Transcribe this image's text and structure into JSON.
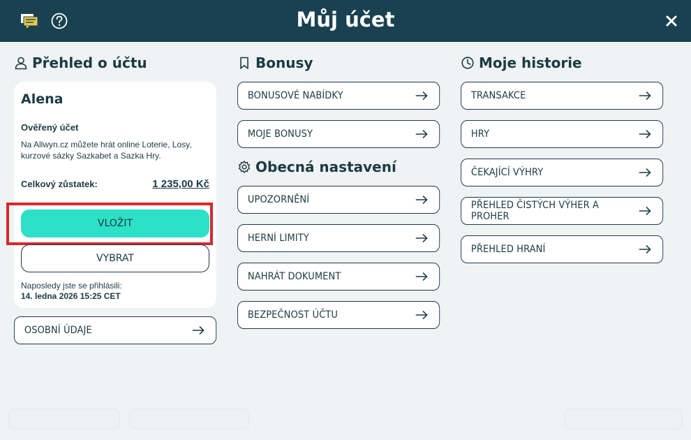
{
  "header": {
    "title": "Můj účet",
    "colors": {
      "header_bg": "#1a4150",
      "accent": "#2de0c8",
      "highlight": "#d62830"
    }
  },
  "overview": {
    "title": "Přehled o účtu",
    "name": "Alena",
    "verified": "Ověřený účet",
    "description": "Na Allwyn.cz můžete hrát online Loterie, Losy, kurzové sázky Sazkabet a Sazka Hry.",
    "balance_label": "Celkový zůstatek:",
    "balance_value": "1 235,00 Kč",
    "deposit_label": "VLOŽIT",
    "withdraw_label": "VYBRAT",
    "last_login_label": "Naposledy jste se přihlásili:",
    "last_login_value": "14. ledna 2026 15:25 CET",
    "personal_data": "OSOBNÍ ÚDAJE"
  },
  "bonuses": {
    "title": "Bonusy",
    "items": [
      "BONUSOVÉ NABÍDKY",
      "MOJE BONUSY"
    ]
  },
  "settings": {
    "title": "Obecná nastavení",
    "items": [
      "UPOZORNĚNÍ",
      "HERNÍ LIMITY",
      "NAHRÁT DOKUMENT",
      "BEZPEČNOST ÚČTU"
    ]
  },
  "history": {
    "title": "Moje historie",
    "items": [
      "TRANSAKCE",
      "HRY",
      "ČEKAJÍCÍ VÝHRY",
      "PŘEHLED ČISTÝCH VÝHER A PROHER",
      "PŘEHLED HRANÍ"
    ]
  }
}
